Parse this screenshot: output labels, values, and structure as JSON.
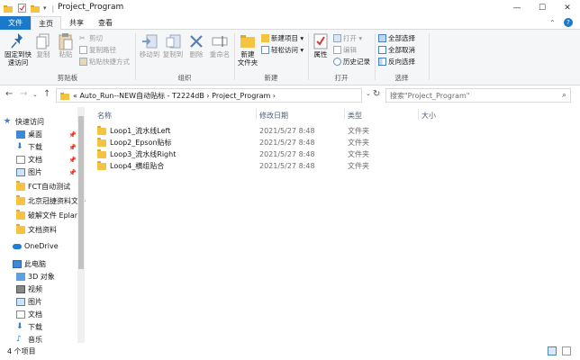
{
  "window": {
    "title": "Project_Program",
    "controls": {
      "minimize": "—",
      "maximize": "☐",
      "close": "✕"
    }
  },
  "tabs": [
    "文件",
    "主页",
    "共享",
    "查看"
  ],
  "ribbon": {
    "groups": {
      "clipboard": "剪贴板",
      "organize": "组织",
      "new": "新建",
      "open": "打开",
      "select": "选择"
    },
    "clipboard": {
      "pin": "固定到快\n速访问",
      "copy": "复制",
      "paste": "粘贴",
      "cut": "剪切",
      "copy_path": "复制路径",
      "paste_shortcut": "粘贴快捷方式"
    },
    "organize": {
      "move_to": "移动到",
      "copy_to": "复制到",
      "delete": "删除",
      "rename": "重命名"
    },
    "new": {
      "new_folder": "新建\n文件夹",
      "new_item": "新建项目 ▾",
      "easy_access": "轻松访问 ▾"
    },
    "open": {
      "properties": "属性",
      "open": "打开 ▾",
      "edit": "编辑",
      "history": "历史记录"
    },
    "select": {
      "select_all": "全部选择",
      "select_none": "全部取消",
      "invert": "反向选择"
    }
  },
  "address": {
    "path": "« Auto_Run--NEW自动贴标 - T2224dB  ›  Project_Program  ›",
    "search_placeholder": "搜索\"Project_Program\""
  },
  "nav": {
    "items": [
      {
        "label": "快速访问",
        "pinned": false
      },
      {
        "label": "桌面",
        "pinned": true
      },
      {
        "label": "下载",
        "pinned": true
      },
      {
        "label": "文档",
        "pinned": true
      },
      {
        "label": "图片",
        "pinned": true
      },
      {
        "label": "FCT自动测试",
        "pinned": false
      },
      {
        "label": "北京冠捷资料文件",
        "pinned": false
      },
      {
        "label": "破解文件 Eplan",
        "pinned": false
      },
      {
        "label": "文档资料",
        "pinned": false
      },
      {
        "label": "OneDrive",
        "pinned": false
      },
      {
        "label": "此电脑",
        "pinned": false
      },
      {
        "label": "3D 对象",
        "pinned": false
      },
      {
        "label": "视频",
        "pinned": false
      },
      {
        "label": "图片",
        "pinned": false
      },
      {
        "label": "文档",
        "pinned": false
      },
      {
        "label": "下载",
        "pinned": false
      },
      {
        "label": "音乐",
        "pinned": false
      }
    ]
  },
  "files": {
    "headers": {
      "name": "名称",
      "date": "修改日期",
      "type": "类型",
      "size": "大小"
    },
    "rows": [
      {
        "name": "Loop1_流水线Left",
        "date": "2021/5/27 8:48",
        "type": "文件夹",
        "size": ""
      },
      {
        "name": "Loop2_Epson贴标",
        "date": "2021/5/27 8:48",
        "type": "文件夹",
        "size": ""
      },
      {
        "name": "Loop3_流水线Right",
        "date": "2021/5/27 8:48",
        "type": "文件夹",
        "size": ""
      },
      {
        "name": "Loop4_横组贴合",
        "date": "2021/5/27 8:48",
        "type": "文件夹",
        "size": ""
      }
    ]
  },
  "status": {
    "count": "4 个项目"
  },
  "colors": {
    "accent": "#1979ca",
    "folder": "#f5c342"
  }
}
